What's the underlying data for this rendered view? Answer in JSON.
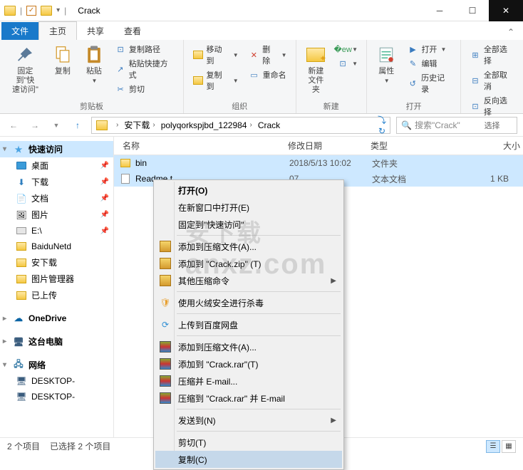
{
  "title": "Crack",
  "tabs": {
    "file": "文件",
    "home": "主页",
    "share": "共享",
    "view": "查看"
  },
  "ribbon": {
    "clipboard": {
      "label": "剪贴板",
      "pin": "固定到\"快\n速访问\"",
      "copy": "复制",
      "paste": "粘贴",
      "copy_path": "复制路径",
      "paste_shortcut": "粘贴快捷方式",
      "cut": "剪切"
    },
    "organize": {
      "label": "组织",
      "move": "移动到",
      "copy_to": "复制到",
      "delete": "删除",
      "rename": "重命名"
    },
    "new": {
      "label": "新建",
      "new_folder": "新建\n文件夹"
    },
    "open": {
      "label": "打开",
      "properties": "属性",
      "open": "打开",
      "edit": "编辑",
      "history": "历史记录"
    },
    "select": {
      "label": "选择",
      "select_all": "全部选择",
      "select_none": "全部取消",
      "invert": "反向选择"
    }
  },
  "breadcrumbs": [
    "安下载",
    "polyqorkspjbd_122984",
    "Crack"
  ],
  "search_placeholder": "搜索\"Crack\"",
  "columns": {
    "name": "名称",
    "date": "修改日期",
    "type": "类型",
    "size": "大小"
  },
  "files": [
    {
      "name": "bin",
      "date": "2018/5/13 10:02",
      "type": "文件夹",
      "size": "",
      "icon": "folder"
    },
    {
      "name": "Readme.t",
      "date": "07",
      "type": "文本文档",
      "size": "1 KB",
      "icon": "txt"
    }
  ],
  "nav": {
    "quick": "快速访问",
    "desktop": "桌面",
    "downloads": "下载",
    "documents": "文档",
    "pictures": "图片",
    "e_drive": "E:\\",
    "baidu": "BaiduNetd",
    "anxia": "安下载",
    "picmgr": "图片管理器",
    "uploaded": "已上传",
    "onedrive": "OneDrive",
    "thispc": "这台电脑",
    "network": "网络",
    "desktop_node": "DESKTOP-"
  },
  "context": {
    "open": "打开(O)",
    "open_new": "在新窗口中打开(E)",
    "pin_quick": "固定到\"快速访问\"",
    "add_archive_a": "添加到压缩文件(A)...",
    "add_zip": "添加到 \"Crack.zip\" (T)",
    "other_zip": "其他压缩命令",
    "huorong": "使用火绒安全进行杀毒",
    "baidu_upload": "上传到百度网盘",
    "add_archive_a2": "添加到压缩文件(A)...",
    "add_rar": "添加到 \"Crack.rar\"(T)",
    "zip_email": "压缩并 E-mail...",
    "rar_email": "压缩到 \"Crack.rar\" 并 E-mail",
    "send_to": "发送到(N)",
    "cut": "剪切(T)",
    "copy": "复制(C)"
  },
  "status": {
    "items": "2 个项目",
    "selected": "已选择 2 个项目"
  },
  "watermark": {
    "cn": "安下载",
    "en": "anxz.com"
  }
}
